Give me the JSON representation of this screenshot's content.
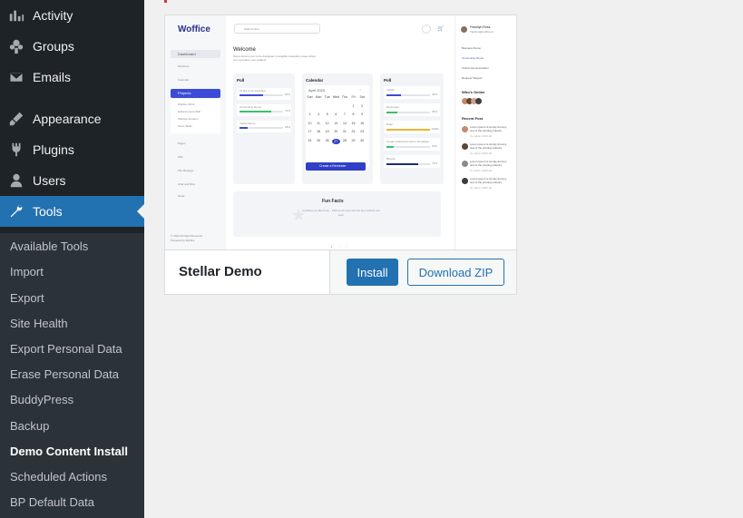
{
  "sidebar": {
    "menu": [
      {
        "label": "Activity",
        "icon": "activity-icon"
      },
      {
        "label": "Groups",
        "icon": "groups-icon"
      },
      {
        "label": "Emails",
        "icon": "email-icon"
      },
      {
        "label": "Appearance",
        "icon": "appearance-brush-icon"
      },
      {
        "label": "Plugins",
        "icon": "plugins-icon"
      },
      {
        "label": "Users",
        "icon": "users-icon"
      },
      {
        "label": "Tools",
        "icon": "tools-wrench-icon"
      }
    ],
    "submenu": [
      "Available Tools",
      "Import",
      "Export",
      "Site Health",
      "Export Personal Data",
      "Erase Personal Data",
      "BuddyPress",
      "Backup",
      "Demo Content Install",
      "Scheduled Actions",
      "BP Default Data"
    ],
    "current_submenu": "Demo Content Install"
  },
  "theme": {
    "name": "Stellar Demo",
    "install_label": "Install",
    "download_label": "Download ZIP",
    "screenshot": {
      "logo_text": "Woffice",
      "search_placeholder": "Search Here",
      "welcome_title": "Welcome",
      "welcome_text": "Some dummy text to be displayed in tangible integration page where you can place your widgets.",
      "nav": [
        "Dashboard",
        "Members",
        "Calendar",
        "Projects",
        "Pages",
        "Wiki",
        "File Manager",
        "Chat and Bots",
        "News"
      ],
      "project_subitems": [
        "Woffice UI/UX",
        "Enhancement Wiki",
        "Website Iteration",
        "Team Tasks"
      ],
      "copyright": "© 2023 All Right Reserved",
      "powered": "Powered by Woffice",
      "poll_left": {
        "title": "Poll",
        "items": [
          {
            "label": "I'd like to be Assistant",
            "pct": "52%"
          },
          {
            "label": "Community Demo",
            "pct": "73%"
          },
          {
            "label": "Yellow Demo",
            "pct": "18%"
          }
        ]
      },
      "calendar": {
        "title": "Calendar",
        "month": "April 2023",
        "weekdays": [
          "Sun",
          "Mon",
          "Tue",
          "Wed",
          "Thu",
          "Fri",
          "Sat"
        ],
        "days": [
          "",
          "",
          "",
          "",
          "",
          "1",
          "2",
          "3",
          "4",
          "5",
          "6",
          "7",
          "8",
          "9",
          "10",
          "11",
          "12",
          "13",
          "14",
          "15",
          "16",
          "17",
          "18",
          "19",
          "20",
          "21",
          "22",
          "23",
          "24",
          "25",
          "26",
          "27",
          "28",
          "29",
          "30"
        ],
        "today": "27",
        "button": "Create a Reminder"
      },
      "poll_right": {
        "title": "Poll",
        "items": [
          {
            "label": "Yellow",
            "pct": "34%",
            "color": "#3b4bd8",
            "fill": 0.34
          },
          {
            "label": "Red Letter",
            "pct": "25%",
            "color": "#3bbf6a",
            "fill": 0.25
          },
          {
            "label": "Ruler",
            "pct": "100%",
            "color": "#f2b233",
            "fill": 1.0
          },
          {
            "label": "Create a Woocommerce Templates",
            "pct": "16%",
            "color": "#3bbf6a",
            "fill": 0.16
          },
          {
            "label": "Bonnet",
            "pct": "73%",
            "color": "#1d2b7a",
            "fill": 0.73
          }
        ]
      },
      "fun_facts_title": "Fun Facts",
      "fun_facts_text": "Anything you like here... Pick up an icon and set any content you wish.",
      "profile_name": "Franklyn Ross",
      "profile_email": "franklyn@woffice.io",
      "right_links": [
        "Business Demo",
        "Community Demo",
        "Online Documentation",
        "Request Support"
      ],
      "whos_online": "Who's Online",
      "recent_post": "Recent Post",
      "posts": [
        {
          "title": "Lorem ipsum is simply dummy text of the printing industry",
          "date": "by Admin 2023-04"
        },
        {
          "title": "Lorem ipsum is simply dummy text of the printing industry",
          "date": "by Admin 2023-04"
        },
        {
          "title": "Lorem ipsum is simply dummy text of the printing industry",
          "date": "by Admin 2023-04"
        },
        {
          "title": "Lorem ipsum is simply dummy text of the printing industry",
          "date": "by Admin 2023-04"
        }
      ]
    }
  },
  "colors": {
    "sidebar_bg": "#1d2327",
    "submenu_bg": "#2c3338",
    "accent": "#2271b1",
    "mockup_accent": "#3b4bd8"
  }
}
